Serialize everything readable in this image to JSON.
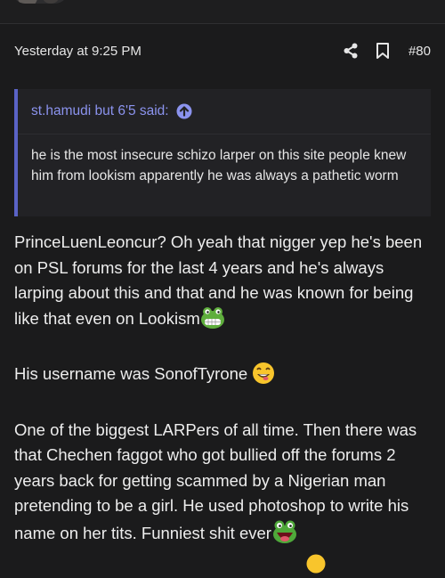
{
  "post": {
    "timestamp": "Yesterday at 9:25 PM",
    "number": "#80",
    "icons": {
      "share": "share-icon",
      "bookmark": "bookmark-icon",
      "quote_jump": "arrow-up-circle-icon"
    }
  },
  "quote": {
    "author": "st.hamudi but 6'5 said:",
    "text": "he is the most insecure schizo larper on this site people knew him from lookism apparently he was always a pathetic worm"
  },
  "body": {
    "para1": "PrinceLuenLeoncur? Oh yeah that nigger yep he's been on PSL forums for the last 4 years and he's always larping about this and that and he was known for being like that even on Lookism",
    "para2": "His username was SonofTyrone",
    "para3": "One of the biggest LARPers of all time. Then there was that Chechen faggot who got bullied off the forums 2 years back for getting scammed by a Nigerian man pretending to be a girl. He used photoshop to write his name on her tits. Funniest shit ever",
    "emojis": [
      "grinning-frog-emoji",
      "grinning-face-emoji",
      "laughing-frog-emoji"
    ]
  },
  "colors": {
    "background": "#1b1b1c",
    "quote_bar": "#5a63c6",
    "quote_author": "#8b93ee",
    "quote_background": "#222225"
  }
}
